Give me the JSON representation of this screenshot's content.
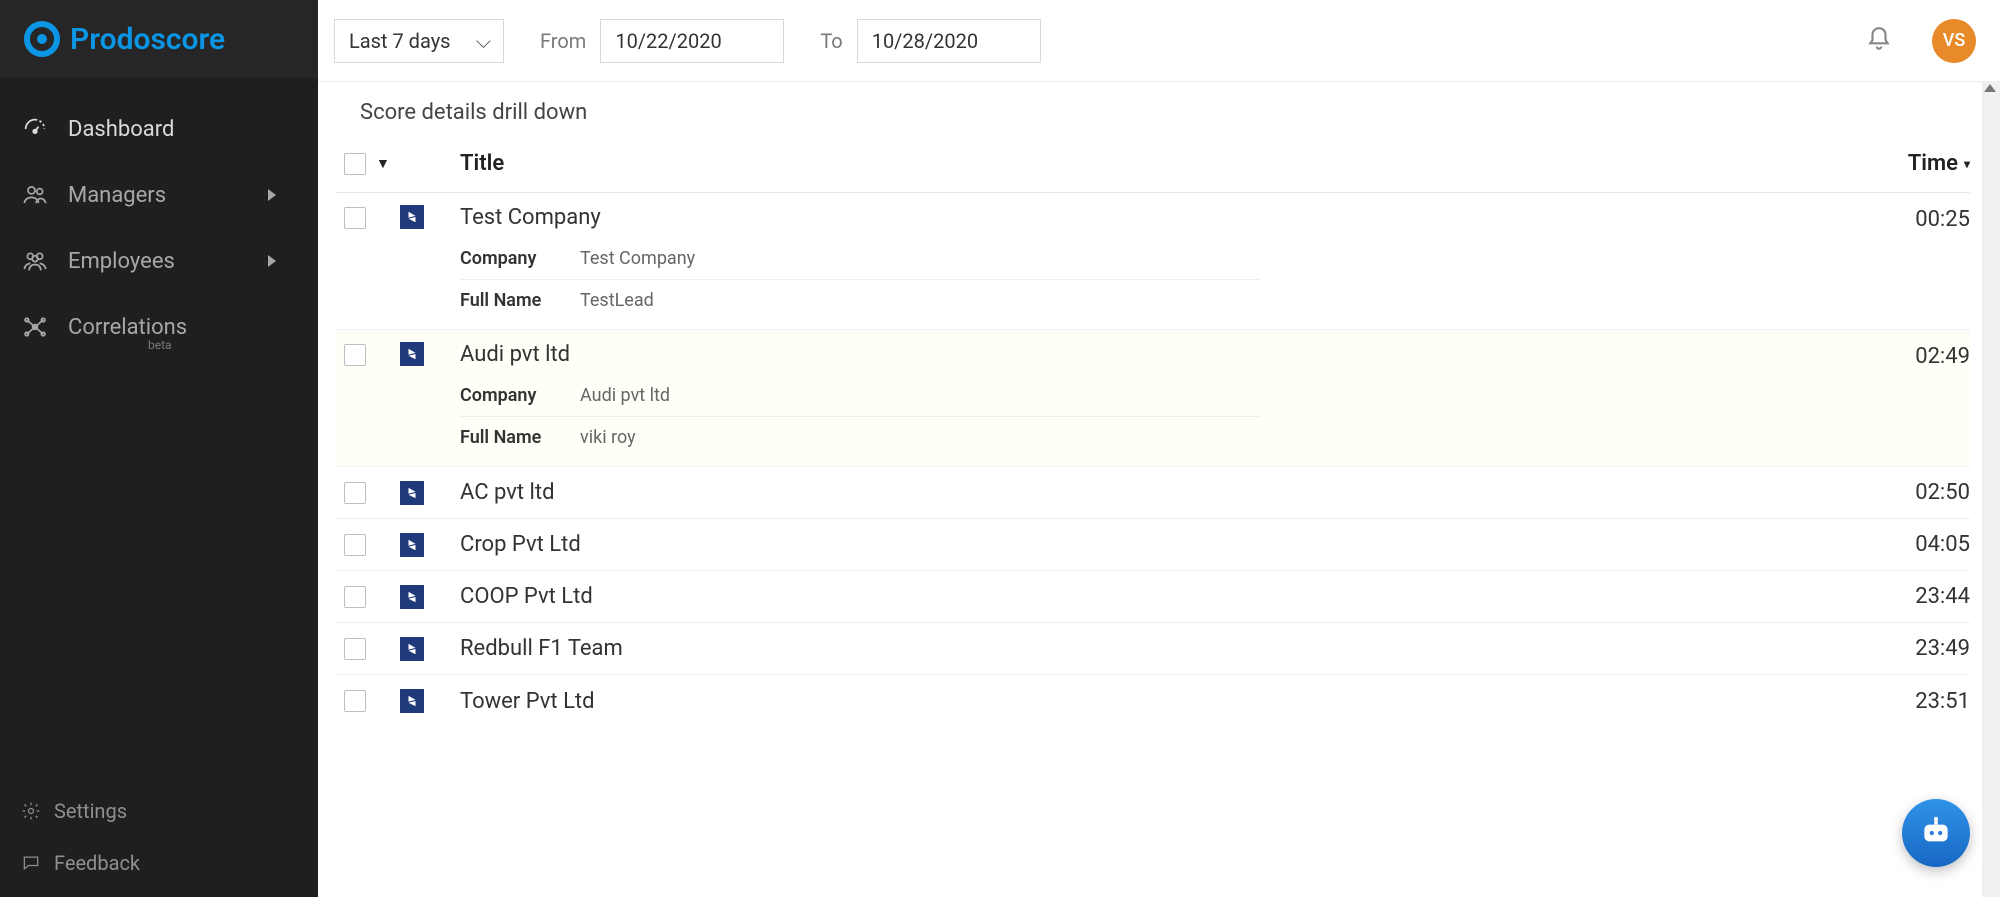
{
  "brand": {
    "name": "Prodoscore"
  },
  "sidebar": {
    "items": [
      {
        "label": "Dashboard"
      },
      {
        "label": "Managers"
      },
      {
        "label": "Employees"
      },
      {
        "label": "Correlations",
        "badge": "beta"
      }
    ],
    "footer": [
      {
        "label": "Settings"
      },
      {
        "label": "Feedback"
      }
    ]
  },
  "topbar": {
    "range": "Last 7 days",
    "from_label": "From",
    "from_value": "10/22/2020",
    "to_label": "To",
    "to_value": "10/28/2020",
    "avatar_initials": "VS"
  },
  "section": {
    "title": "Score details drill down"
  },
  "columns": {
    "title": "Title",
    "time": "Time"
  },
  "detail_labels": {
    "company": "Company",
    "full_name": "Full Name"
  },
  "rows": [
    {
      "title": "Test Company",
      "time": "00:25",
      "company": "Test Company",
      "full_name": "TestLead"
    },
    {
      "title": "Audi pvt ltd",
      "time": "02:49",
      "company": "Audi pvt ltd",
      "full_name": "viki roy"
    },
    {
      "title": "AC pvt ltd",
      "time": "02:50"
    },
    {
      "title": "Crop Pvt Ltd",
      "time": "04:05"
    },
    {
      "title": "COOP Pvt Ltd",
      "time": "23:44"
    },
    {
      "title": "Redbull F1 Team",
      "time": "23:49"
    },
    {
      "title": "Tower Pvt Ltd",
      "time": "23:51"
    }
  ]
}
